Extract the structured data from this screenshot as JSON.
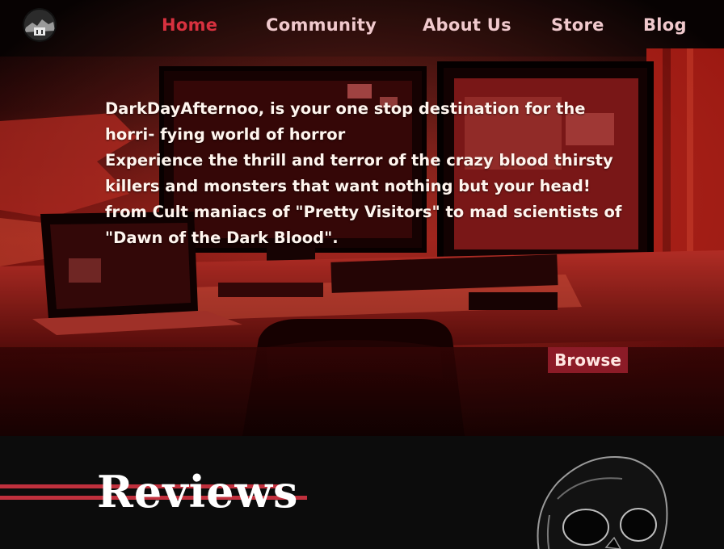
{
  "logo": {
    "icon": "skull-castle-logo-icon"
  },
  "nav": {
    "items": [
      {
        "label": "Home",
        "active": true
      },
      {
        "label": "Community",
        "active": false
      },
      {
        "label": "About Us",
        "active": false
      },
      {
        "label": "Store",
        "active": false
      },
      {
        "label": "Blog",
        "active": false
      }
    ]
  },
  "hero": {
    "intro_line1": "DarkDayAfternoo, is your one stop destination for the horri- fying world of horror",
    "intro_line2": "Experience the thrill and terror of the crazy blood thirsty killers and monsters that want nothing but your head! from Cult maniacs of \"Pretty Visitors\" to mad scientists of \"Dawn of the Dark Blood\".",
    "browse_label": "Browse",
    "background": "red-tinted desk with computer monitors and laptop"
  },
  "reviews": {
    "title": "Reviews",
    "decoration_icon": "skull-icon"
  },
  "colors": {
    "accent_red": "#d8313f",
    "nav_text": "#f0c9cd",
    "button_bg": "#8c1b27",
    "section_bg": "#0c0c0c",
    "stripe": "#c0303d"
  }
}
